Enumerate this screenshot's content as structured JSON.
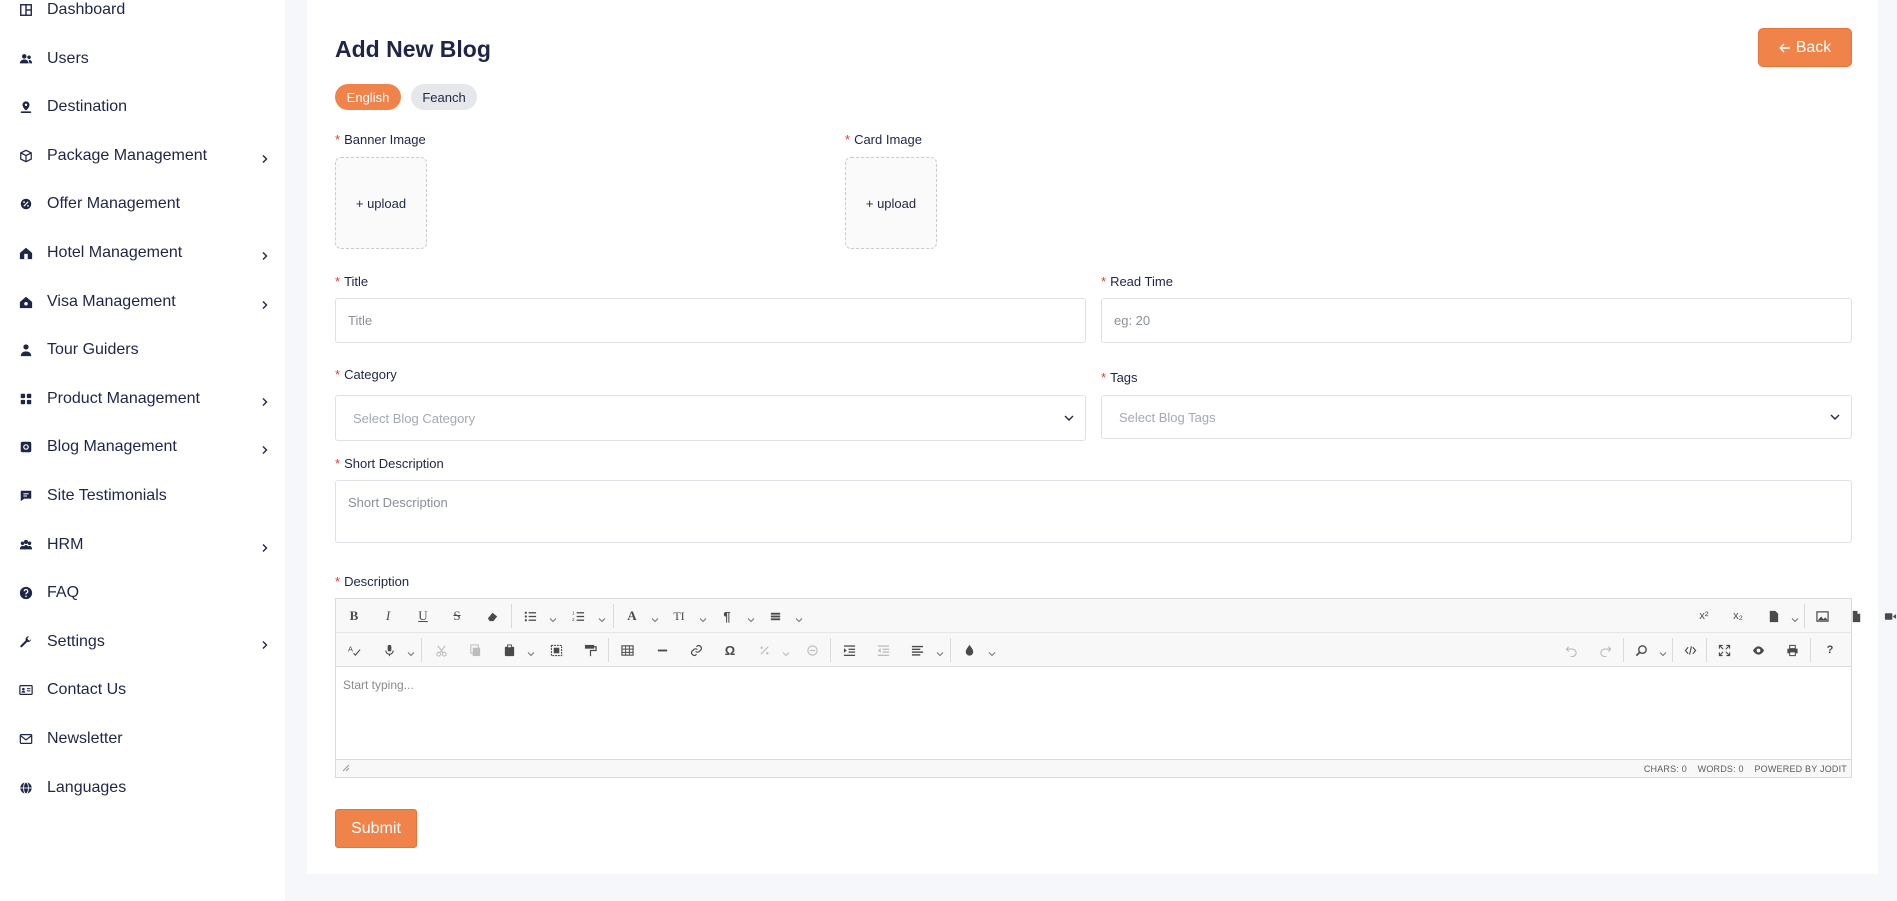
{
  "sidebar": {
    "items": [
      {
        "label": "Dashboard",
        "icon": "dashboard-icon",
        "has_children": false
      },
      {
        "label": "Users",
        "icon": "users-icon",
        "has_children": false
      },
      {
        "label": "Destination",
        "icon": "location-pin-icon",
        "has_children": false
      },
      {
        "label": "Package Management",
        "icon": "package-box-icon",
        "has_children": true
      },
      {
        "label": "Offer Management",
        "icon": "offer-icon",
        "has_children": false
      },
      {
        "label": "Hotel Management",
        "icon": "hotel-icon",
        "has_children": true
      },
      {
        "label": "Visa Management",
        "icon": "visa-icon",
        "has_children": true
      },
      {
        "label": "Tour Guiders",
        "icon": "user-icon",
        "has_children": false
      },
      {
        "label": "Product Management",
        "icon": "grid-icon",
        "has_children": true
      },
      {
        "label": "Blog Management",
        "icon": "blog-icon",
        "has_children": true
      },
      {
        "label": "Site Testimonials",
        "icon": "comment-icon",
        "has_children": false
      },
      {
        "label": "HRM",
        "icon": "team-icon",
        "has_children": true
      },
      {
        "label": "FAQ",
        "icon": "question-circle-icon",
        "has_children": false
      },
      {
        "label": "Settings",
        "icon": "wrench-icon",
        "has_children": true
      },
      {
        "label": "Contact Us",
        "icon": "contact-card-icon",
        "has_children": false
      },
      {
        "label": "Newsletter",
        "icon": "mail-icon",
        "has_children": false
      },
      {
        "label": "Languages",
        "icon": "globe-icon",
        "has_children": false
      }
    ]
  },
  "page": {
    "title": "Add New Blog",
    "back_label": "Back",
    "languages": [
      "English",
      "Feanch"
    ],
    "active_language": "English"
  },
  "form": {
    "banner_image_label": "Banner Image",
    "card_image_label": "Card Image",
    "upload_label": "+ upload",
    "title_label": "Title",
    "title_placeholder": "Title",
    "read_time_label": "Read Time",
    "read_time_placeholder": "eg: 20",
    "category_label": "Category",
    "category_placeholder": "Select Blog Category",
    "tags_label": "Tags",
    "tags_placeholder": "Select Blog Tags",
    "short_description_label": "Short Description",
    "short_description_placeholder": "Short Description",
    "description_label": "Description",
    "required_mark": "*",
    "submit_label": "Submit"
  },
  "editor": {
    "placeholder": "Start typing...",
    "chars": "CHARS: 0",
    "words": "WORDS: 0",
    "powered_by": "POWERED BY JODIT",
    "superscript_label": "x²",
    "subscript_label": "x₂",
    "help_label": "?"
  },
  "colors": {
    "accent": "#f0834a",
    "navy": "#1f2547",
    "required": "#e53935",
    "background": "#f6f7fb"
  }
}
